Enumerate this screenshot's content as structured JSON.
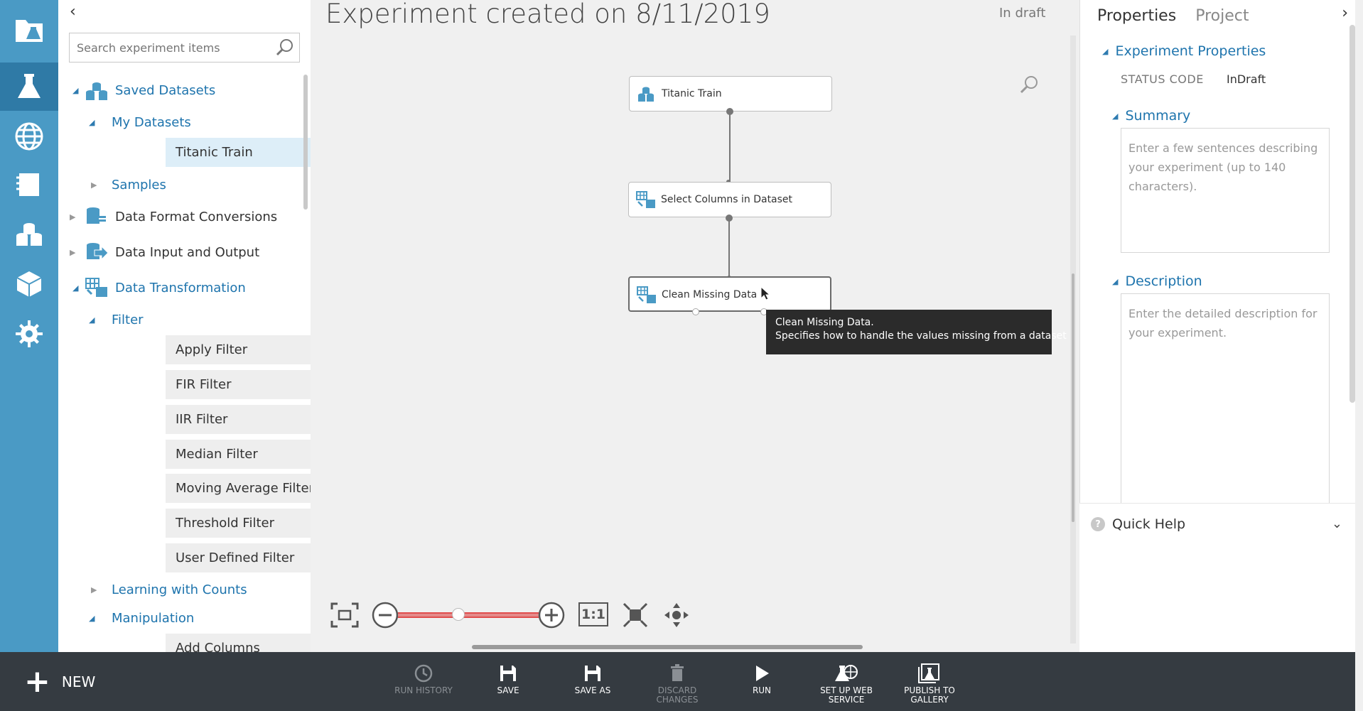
{
  "palette": {
    "search_placeholder": "Search experiment items",
    "tree": {
      "saved_datasets": "Saved Datasets",
      "my_datasets": "My Datasets",
      "titanic_train": "Titanic Train",
      "samples": "Samples",
      "data_format_conversions": "Data Format Conversions",
      "data_input_output": "Data Input and Output",
      "data_transformation": "Data Transformation",
      "filter": "Filter",
      "filter_items": [
        "Apply Filter",
        "FIR Filter",
        "IIR Filter",
        "Median Filter",
        "Moving Average Filter",
        "Threshold Filter",
        "User Defined Filter"
      ],
      "learning_with_counts": "Learning with Counts",
      "manipulation": "Manipulation",
      "add_columns": "Add Columns"
    }
  },
  "canvas": {
    "title": "Experiment created on 8/11/2019",
    "status": "In draft",
    "nodes": {
      "titanic": "Titanic Train",
      "select_columns": "Select Columns in Dataset",
      "clean_missing": "Clean Missing Data"
    },
    "tooltip": {
      "line1": "Clean Missing Data.",
      "line2": "Specifies how to handle the values missing from a dataset"
    },
    "zoom_ratio_label": "1:1"
  },
  "properties": {
    "tab_properties": "Properties",
    "tab_project": "Project",
    "experiment_properties": "Experiment Properties",
    "status_code_label": "STATUS CODE",
    "status_code_value": "InDraft",
    "summary_title": "Summary",
    "summary_placeholder": "Enter a few sentences describing your experiment (up to 140 characters).",
    "description_title": "Description",
    "description_placeholder": "Enter the detailed description for your experiment.",
    "quick_help": "Quick Help"
  },
  "bottombar": {
    "new": "NEW",
    "run_history": "RUN HISTORY",
    "save": "SAVE",
    "save_as": "SAVE AS",
    "discard": "DISCARD CHANGES",
    "run": "RUN",
    "setup_web_1": "SET UP WEB",
    "setup_web_2": "SERVICE",
    "publish_1": "PUBLISH TO",
    "publish_2": "GALLERY"
  },
  "colors": {
    "rail": "#4a9ac5",
    "accent_blue": "#1e74ad",
    "bottombar": "#353b41",
    "zoom_track": "#e04d4d"
  }
}
